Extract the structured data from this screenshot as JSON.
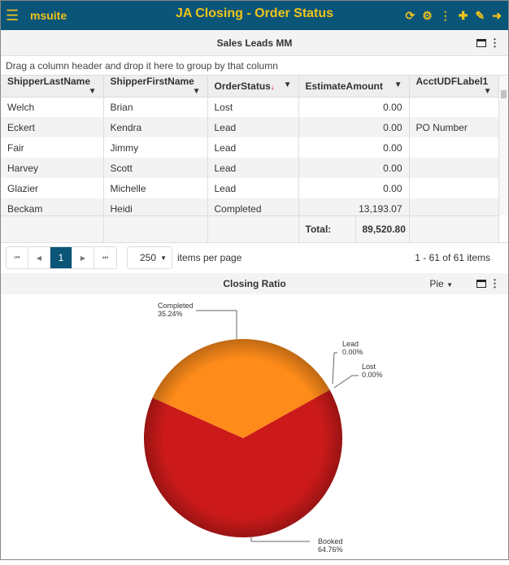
{
  "header": {
    "brand": "msuite",
    "title": "JA Closing - Order Status",
    "icons": [
      "refresh-icon",
      "gear-icon",
      "kebab-icon",
      "plus-icon",
      "pencil-icon",
      "logout-icon"
    ]
  },
  "grid": {
    "title": "Sales Leads MM",
    "group_hint": "Drag a column header and drop it here to group by that column",
    "columns": [
      "ShipperLastName",
      "ShipperFirstName",
      "OrderStatus",
      "EstimateAmount",
      "AcctUDFLabel1"
    ],
    "rows": [
      [
        "Welch",
        "Brian",
        "Lost",
        "0.00",
        ""
      ],
      [
        "Eckert",
        "Kendra",
        "Lead",
        "0.00",
        "PO Number"
      ],
      [
        "Fair",
        "Jimmy",
        "Lead",
        "0.00",
        ""
      ],
      [
        "Harvey",
        "Scott",
        "Lead",
        "0.00",
        ""
      ],
      [
        "Glazier",
        "Michelle",
        "Lead",
        "0.00",
        ""
      ],
      [
        "Beckam",
        "Heidi",
        "Completed",
        "13,193.07",
        ""
      ]
    ],
    "total_label": "Total:",
    "total_value": "89,520.80"
  },
  "pager": {
    "first": "⏮",
    "prev": "◀",
    "page": "1",
    "next": "▶",
    "last": "⏭",
    "page_size": "250",
    "items_per_page": "items per page",
    "count": "1 - 61 of 61 items"
  },
  "chart_panel": {
    "title": "Closing Ratio",
    "type_select": "Pie"
  },
  "chart_data": {
    "type": "pie",
    "title": "Closing Ratio",
    "slices": [
      {
        "label": "Completed",
        "value": 35.24,
        "pct": "35.24%",
        "color": "#ff8c1a"
      },
      {
        "label": "Lead",
        "value": 0,
        "pct": "0.00%",
        "color": "#999999"
      },
      {
        "label": "Lost",
        "value": 0,
        "pct": "0.00%",
        "color": "#666666"
      },
      {
        "label": "Booked",
        "value": 64.76,
        "pct": "64.76%",
        "color": "#cc1a1a"
      }
    ]
  },
  "colors": {
    "header_bg": "#0b5579",
    "header_fg": "#f0c419"
  }
}
